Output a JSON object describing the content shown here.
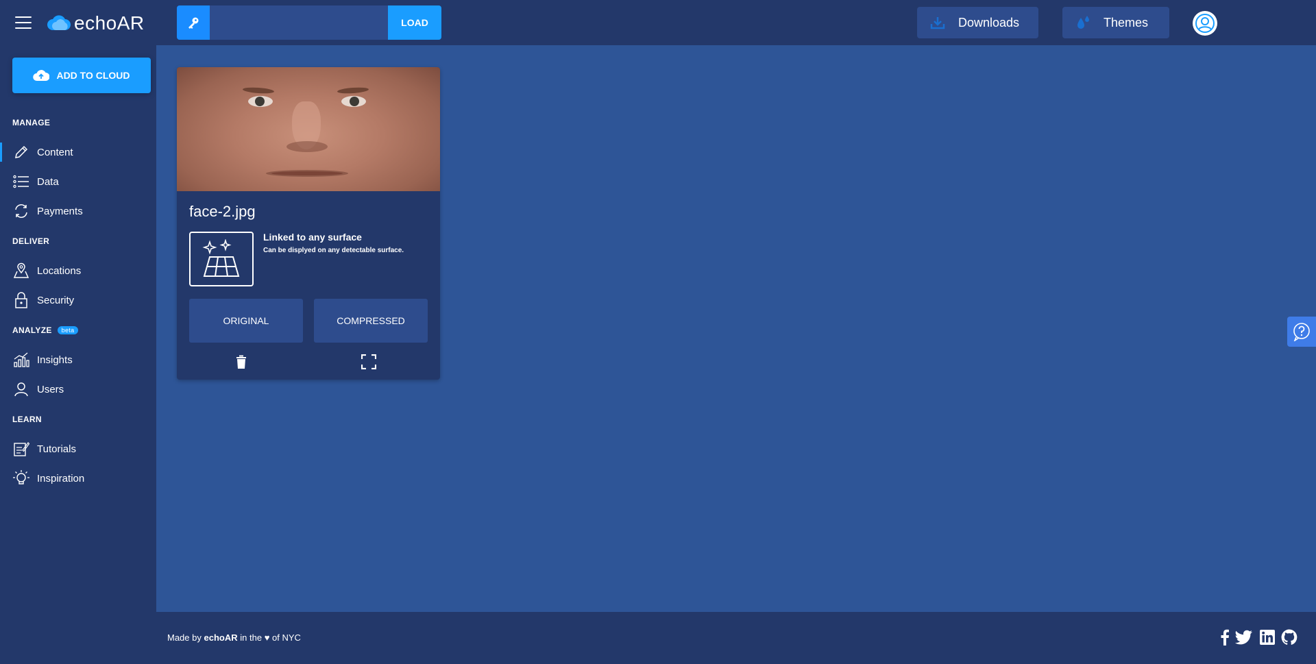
{
  "header": {
    "logo_text": "echoAR",
    "api_key_placeholder": "",
    "load_label": "LOAD",
    "downloads_label": "Downloads",
    "themes_label": "Themes"
  },
  "sidebar": {
    "add_to_cloud_label": "ADD TO CLOUD",
    "sections": {
      "manage": "MANAGE",
      "deliver": "DELIVER",
      "analyze": "ANALYZE",
      "analyze_badge": "beta",
      "learn": "LEARN"
    },
    "items": {
      "content": "Content",
      "data": "Data",
      "payments": "Payments",
      "locations": "Locations",
      "security": "Security",
      "insights": "Insights",
      "users": "Users",
      "tutorials": "Tutorials",
      "inspiration": "Inspiration"
    }
  },
  "card": {
    "filename": "face-2.jpg",
    "surface_title": "Linked to any surface",
    "surface_desc": "Can be displyed on any detectable surface.",
    "original_label": "ORIGINAL",
    "compressed_label": "COMPRESSED"
  },
  "footer": {
    "prefix": "Made by",
    "brand": "echoAR",
    "middle": "in the",
    "heart": "♥",
    "suffix": "of NYC"
  },
  "colors": {
    "accent": "#1a9dff",
    "nav_bg": "#23386a",
    "main_bg": "#2e5597",
    "button_bg": "#2e4c8d"
  }
}
